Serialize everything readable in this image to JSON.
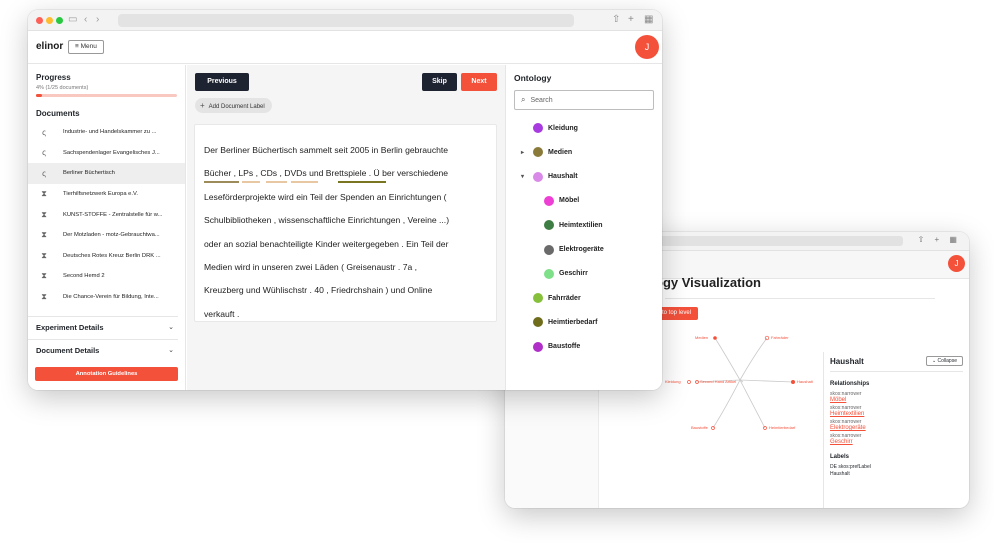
{
  "back_window": {
    "title": "ogy Visualization",
    "back_button": "to top level",
    "graph_nodes": [
      "Medien",
      "Fahrräder",
      "Kleidung",
      "Second Hand Artikel",
      "Haushalt",
      "Baustoffe",
      "Heimtierbedarf"
    ],
    "detail": {
      "title": "Haushalt",
      "collapse": "Collapse",
      "relationships_heading": "Relationships",
      "relationships": [
        {
          "predicate": "skos:narrower",
          "target": "Möbel"
        },
        {
          "predicate": "skos:narrower",
          "target": "Heimtextilien"
        },
        {
          "predicate": "skos:narrower",
          "target": "Elektrogeräte"
        },
        {
          "predicate": "skos:narrower",
          "target": "Geschirr"
        }
      ],
      "labels_heading": "Labels",
      "label_predicate": "DE skos:prefLabel",
      "label_value": "Haushalt"
    },
    "avatar": "J"
  },
  "app": {
    "brand": "elinor",
    "menu_label": "Menu",
    "avatar": "J"
  },
  "sidebar": {
    "progress_heading": "Progress",
    "progress_text": "4% (1/25 documents)",
    "progress_fraction": 0.04,
    "documents_heading": "Documents",
    "documents": [
      {
        "icon": "progress-icon",
        "label": "Industrie- und Handelskammer zu ..."
      },
      {
        "icon": "progress-icon",
        "label": "Sachspendenlager Evangelisches J..."
      },
      {
        "icon": "progress-icon",
        "label": "Berliner Büchertisch"
      },
      {
        "icon": "hourglass-icon",
        "label": "Tierhilfsnetzwerk Europa e.V."
      },
      {
        "icon": "hourglass-icon",
        "label": "KUNST-STOFFE - Zentralstelle für w..."
      },
      {
        "icon": "hourglass-icon",
        "label": "Der Motzladen - motz-Gebrauchtwa..."
      },
      {
        "icon": "hourglass-icon",
        "label": "Deutsches Rotes Kreuz Berlin DRK ..."
      },
      {
        "icon": "hourglass-icon",
        "label": "Second Hemd 2"
      },
      {
        "icon": "hourglass-icon",
        "label": "Die Chance-Verein für Bildung, Inte..."
      }
    ],
    "active_index": 2,
    "experiment_details": "Experiment Details",
    "document_details": "Document Details",
    "guidelines_button": "Annotation Guidelines"
  },
  "toolbar": {
    "previous": "Previous",
    "skip": "Skip",
    "next": "Next",
    "add_label": "Add Document Label"
  },
  "document": {
    "lines": [
      "Der Berliner Büchertisch sammelt seit 2005 in Berlin gebrauchte",
      "Bücher , LPs , CDs , DVDs und Brettspiele . Ü ber verschiedene",
      "Leseförderprojekte wird ein Teil der Spenden an Einrichtungen (",
      "Schulbibliotheken , wissenschaftliche Einrichtungen , Vereine ...)",
      "oder an sozial benachteiligte Kinder weitergegeben . Ein Teil der",
      "Medien wird in unseren zwei Läden ( Greisenaustr . 7a ,",
      "Kreuzberg und Wühlischstr . 40 , Friedrchshain ) und Online",
      "verkauft ."
    ]
  },
  "ontology": {
    "heading": "Ontology",
    "search_placeholder": "Search",
    "items": [
      {
        "label": "Kleidung",
        "color": "#a83be0",
        "level": 0,
        "caret": ""
      },
      {
        "label": "Medien",
        "color": "#8a7a3a",
        "level": 0,
        "caret": "▸"
      },
      {
        "label": "Haushalt",
        "color": "#d98ae8",
        "level": 0,
        "caret": "▾"
      },
      {
        "label": "Möbel",
        "color": "#ee3fd4",
        "level": 1,
        "caret": ""
      },
      {
        "label": "Heimtextilien",
        "color": "#3e7d43",
        "level": 1,
        "caret": ""
      },
      {
        "label": "Elektrogeräte",
        "color": "#6a6a6a",
        "level": 1,
        "caret": ""
      },
      {
        "label": "Geschirr",
        "color": "#7fe08a",
        "level": 1,
        "caret": ""
      },
      {
        "label": "Fahrräder",
        "color": "#86c03a",
        "level": 0,
        "caret": ""
      },
      {
        "label": "Heimtierbedarf",
        "color": "#6f6d1c",
        "level": 0,
        "caret": ""
      },
      {
        "label": "Baustoffe",
        "color": "#b02fc8",
        "level": 0,
        "caret": ""
      }
    ]
  },
  "colors": {
    "accent": "#f4513b",
    "dark": "#1e2331"
  }
}
